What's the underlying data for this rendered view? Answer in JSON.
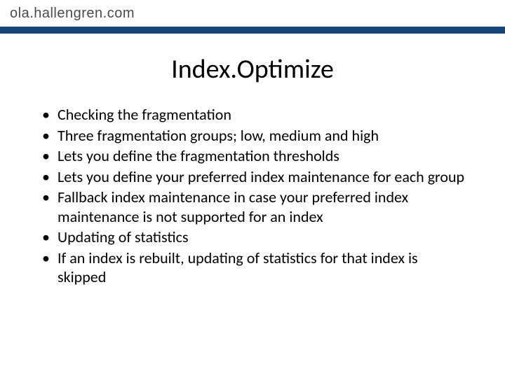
{
  "header": {
    "site": "ola.hallengren.com"
  },
  "title": "Index.Optimize",
  "bullets": [
    "Checking the fragmentation",
    "Three fragmentation groups; low, medium and high",
    "Lets you define the fragmentation thresholds",
    "Lets you define your preferred index maintenance for each group",
    "Fallback index maintenance in case your preferred index maintenance is not supported for an index",
    "Updating of statistics",
    "If an index is rebuilt, updating of statistics for that index is skipped"
  ]
}
